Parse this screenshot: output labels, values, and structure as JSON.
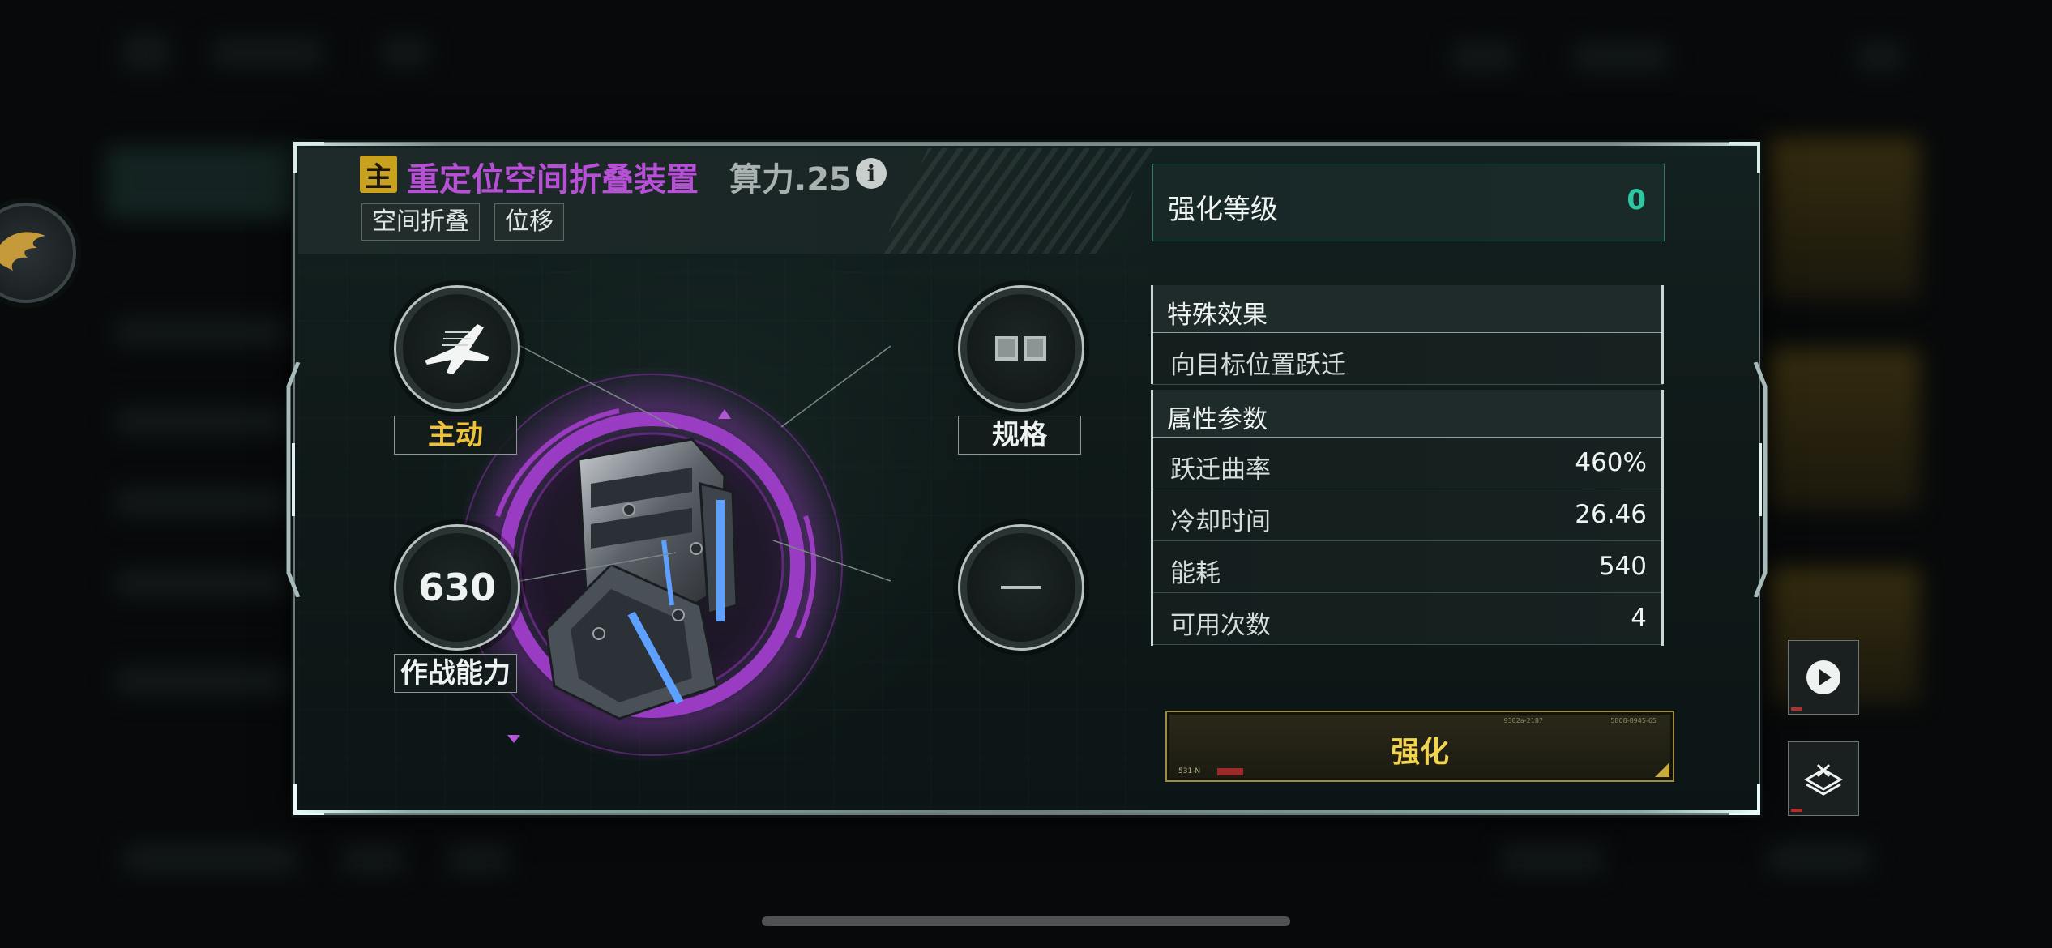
{
  "header": {
    "main_badge": "主",
    "device_name": "重定位空间折叠装置",
    "compute": "算力.25",
    "info_icon": "i",
    "tags": [
      "空间折叠",
      "位移"
    ]
  },
  "slots": {
    "type_label": "主动",
    "spec_label": "规格",
    "combat_power_value": "630",
    "combat_power_label": "作战能力"
  },
  "enhance_level": {
    "label": "强化等级",
    "value": "0"
  },
  "special_effect": {
    "title": "特殊效果",
    "text": "向目标位置跃迁"
  },
  "attributes": {
    "title": "属性参数",
    "rows": [
      {
        "name": "跃迁曲率",
        "value": "460%"
      },
      {
        "name": "冷却时间",
        "value": "26.46"
      },
      {
        "name": "能耗",
        "value": "540"
      },
      {
        "name": "可用次数",
        "value": "4"
      }
    ]
  },
  "enhance_button": {
    "label": "强化",
    "code_left": "531-N",
    "code_right_1": "9382a-2187",
    "code_right_2": "5808-8945-65"
  },
  "colors": {
    "title_purple": "#b750d6",
    "badge_gold": "#c8a21f",
    "type_label_gold": "#f0c23a",
    "enhance_value_teal": "#2cc7a3",
    "enhance_btn_text": "#f2d44e"
  },
  "icons": [
    "info-icon",
    "fighter-jet-icon",
    "spec-slots-icon",
    "empty-slot-dash-icon",
    "play-icon",
    "dismantle-icon",
    "avatar-emblem-icon"
  ]
}
